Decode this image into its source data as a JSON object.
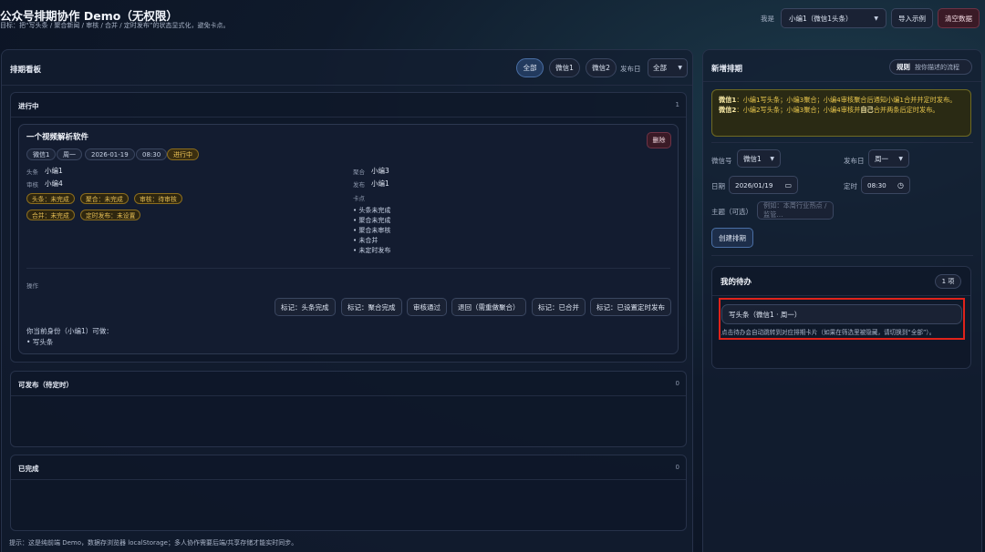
{
  "header": {
    "title": "公众号排期协作 Demo（无权限）",
    "subtitle": "目标：把“写头条 / 聚合新闻 / 审核 / 合并 / 定时发布”的状态显式化，避免卡点。",
    "me_label": "我是",
    "me_value": "小编1（微信1头条）",
    "import_label": "导入示例",
    "clear_label": "清空数据"
  },
  "board": {
    "title": "排期看板",
    "filters": [
      "全部",
      "微信1",
      "微信2"
    ],
    "active_filter": "全部",
    "day_label": "发布日",
    "day_value": "全部",
    "sections": {
      "in_progress": {
        "title": "进行中",
        "count": "1"
      },
      "publishable": {
        "title": "可发布（待定时）",
        "count": "0"
      },
      "done": {
        "title": "已完成",
        "count": "0"
      }
    },
    "card": {
      "title": "一个视频解析软件",
      "chips": [
        "微信1",
        "周一",
        "2026-01-19",
        "08:30"
      ],
      "status": "进行中",
      "delete_label": "删除",
      "headline_key": "头条",
      "headline_val": "小编1",
      "review_key": "审核",
      "review_val": "小编4",
      "aggregate_key": "聚合",
      "aggregate_val": "小编3",
      "publish_key": "发布",
      "publish_val": "小编1",
      "tags": [
        "头条：未完成",
        "聚合：未完成",
        "审核：待审核",
        "合并：未完成",
        "定时发布：未设置"
      ],
      "blockers_title": "卡点",
      "blockers": [
        "• 头条未完成",
        "• 聚合未完成",
        "• 聚合未审核",
        "• 未合并",
        "• 未定时发布"
      ],
      "ops_title": "操作",
      "ops": [
        "标记：头条完成",
        "标记：聚合完成",
        "审核通过",
        "退回（需重做聚合）",
        "标记：已合并",
        "标记：已设置定时发布"
      ],
      "can_do_title": "你当前身份（小编1）可做：",
      "can_do": "• 写头条"
    }
  },
  "footer": "提示：这是纯前端 Demo，数据存浏览器 localStorage；多人协作需要后端/共享存储才能实时同步。",
  "new_schedule": {
    "title": "新增排期",
    "rules_btn": "规则",
    "rules_hint": "按你描述的流程",
    "rule1_name": "微信1",
    "rule1_text": "：小编1写头条；小编3聚合；小编4审核聚合后通知小编1合并并定时发布。",
    "rule2_name": "微信2",
    "rule2_text_a": "：小编2写头条；小编3聚合；小编4审核并",
    "rule2_bold": "自己",
    "rule2_text_b": "合并两条后定时发布。",
    "account_label": "微信号",
    "account_value": "微信1",
    "day_label": "发布日",
    "day_value": "周一",
    "date_label": "日期",
    "date_value": "2026/01/19",
    "time_label": "定时",
    "time_value": "08:30",
    "topic_label": "主题（可选）",
    "topic_placeholder": "例如：本周行业热点 / 监管…",
    "create_label": "创建排期"
  },
  "todo": {
    "title": "我的待办",
    "count": "1 项",
    "item": "写头条（微信1 · 周一）",
    "hint": "点击待办会自动跳转到对应排期卡片（如果在筛选里被隐藏，请切换到“全部”）。"
  },
  "colors": {
    "accent": "#4a6fa5",
    "status_warn": "#f0c75a",
    "highlight": "#e0231b"
  }
}
